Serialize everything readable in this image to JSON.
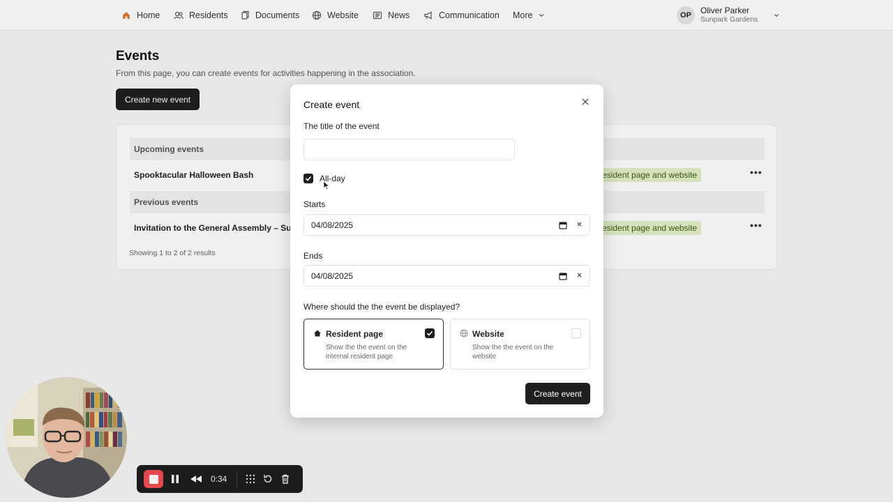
{
  "nav": {
    "items": [
      {
        "label": "Home",
        "icon": "home-icon"
      },
      {
        "label": "Residents",
        "icon": "users-icon"
      },
      {
        "label": "Documents",
        "icon": "document-icon"
      },
      {
        "label": "Website",
        "icon": "globe-icon"
      },
      {
        "label": "News",
        "icon": "newspaper-icon"
      },
      {
        "label": "Communication",
        "icon": "megaphone-icon"
      }
    ],
    "more_label": "More",
    "user": {
      "initials": "OP",
      "name": "Oliver Parker",
      "org": "Sunpark Gardens"
    }
  },
  "page": {
    "title": "Events",
    "subtitle": "From this page, you can create events for activities happening in the association.",
    "create_button": "Create new event"
  },
  "events": {
    "upcoming_header": "Upcoming events",
    "previous_header": "Previous events",
    "upcoming": [
      {
        "title": "Spooktacular Halloween Bash",
        "visibility": "esident page and website"
      }
    ],
    "previous": [
      {
        "title": "Invitation to the General Assembly – Sunpar",
        "visibility": "esident page and website"
      }
    ],
    "results": "Showing 1 to 2 of 2 results"
  },
  "modal": {
    "title": "Create event",
    "title_label": "The title of the event",
    "title_value": "",
    "all_day_label": "All-day",
    "all_day_checked": true,
    "starts_label": "Starts",
    "starts_value": "04/08/2025",
    "ends_label": "Ends",
    "ends_value": "04/08/2025",
    "display_question": "Where should the the event be displayed?",
    "options": [
      {
        "title": "Resident page",
        "desc": "Show the the event on the internal resident page",
        "checked": true,
        "icon": "home-icon"
      },
      {
        "title": "Website",
        "desc": "Show the the event on the website",
        "checked": false,
        "icon": "globe-icon"
      }
    ],
    "submit": "Create event"
  },
  "recorder": {
    "time": "0:34"
  },
  "colors": {
    "accent": "#1f1f1f",
    "tag_bg": "#e3f1c6",
    "tag_text": "#3c5a14",
    "record_red": "#e5484d"
  }
}
